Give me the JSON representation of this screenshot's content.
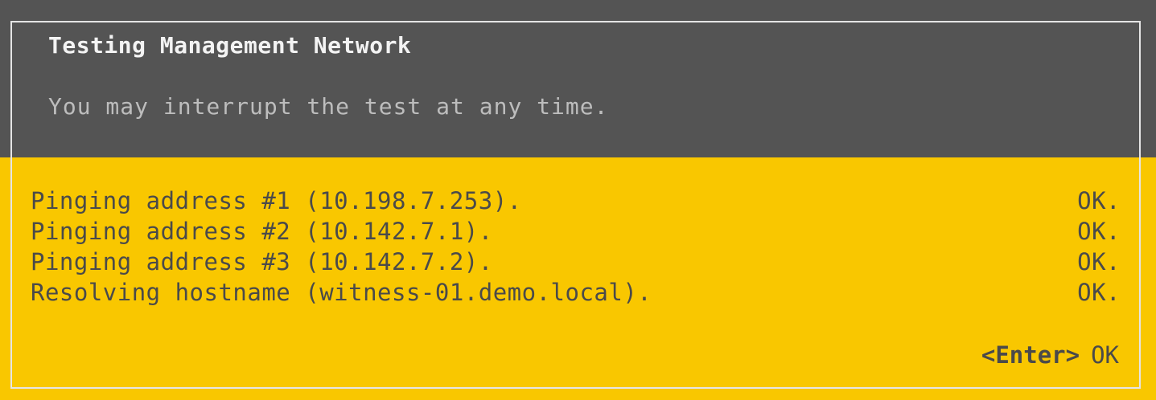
{
  "dialog": {
    "title": "Testing Management Network",
    "subtitle": "You may interrupt the test at any time."
  },
  "results": [
    {
      "text": "Pinging address #1 (10.198.7.253).",
      "status": "OK."
    },
    {
      "text": "Pinging address #2 (10.142.7.1).",
      "status": "OK."
    },
    {
      "text": "Pinging address #3 (10.142.7.2).",
      "status": "OK."
    },
    {
      "text": "Resolving hostname (witness-01.demo.local).",
      "status": "OK."
    }
  ],
  "action": {
    "key": "<Enter>",
    "label": "OK"
  },
  "colors": {
    "header_bg": "#545454",
    "body_bg": "#f9c700",
    "title_text": "#f3f3f3",
    "subtitle_text": "#bdbdbd",
    "body_text": "#4a4a4a"
  }
}
